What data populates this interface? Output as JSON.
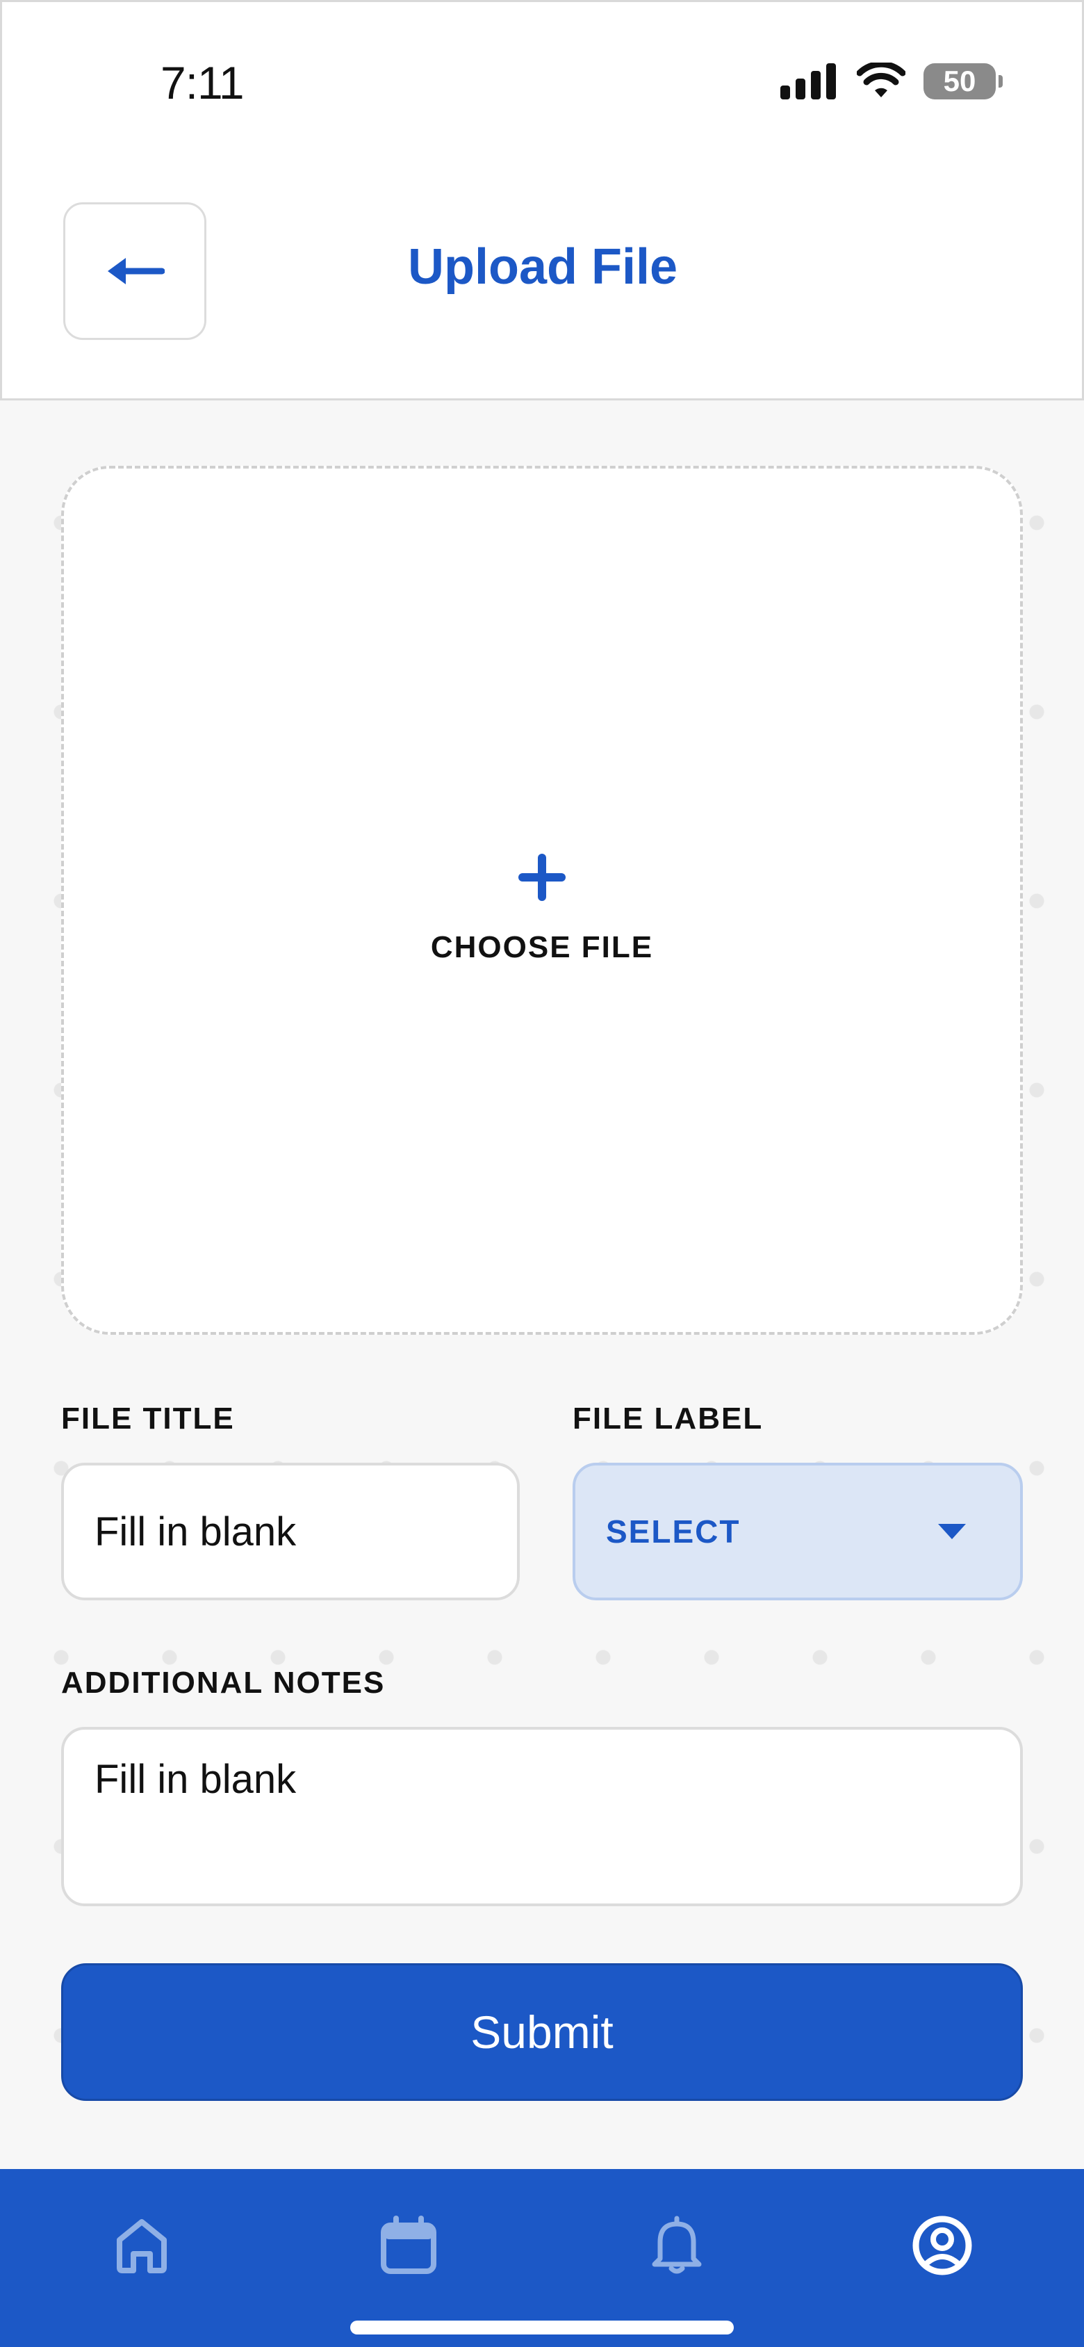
{
  "status_bar": {
    "time": "7:11",
    "battery": "50"
  },
  "header": {
    "title": "Upload File",
    "back_icon": "arrow-left-icon"
  },
  "upload": {
    "icon": "plus-icon",
    "label": "CHOOSE FILE"
  },
  "form": {
    "file_title": {
      "label": "FILE TITLE",
      "placeholder": "Fill in blank"
    },
    "file_label": {
      "label": "FILE LABEL",
      "selected": "SELECT"
    },
    "additional_notes": {
      "label": "ADDITIONAL NOTES",
      "placeholder": "Fill in blank"
    },
    "submit_label": "Submit"
  },
  "bottom_nav": {
    "items": [
      {
        "icon": "home-icon",
        "active": false
      },
      {
        "icon": "calendar-icon",
        "active": false
      },
      {
        "icon": "bell-icon",
        "active": false
      },
      {
        "icon": "profile-icon",
        "active": true
      }
    ]
  },
  "colors": {
    "primary": "#1c58c6",
    "select_bg": "#dce6f6",
    "inactive_nav_icon": "#8fb0e6"
  }
}
